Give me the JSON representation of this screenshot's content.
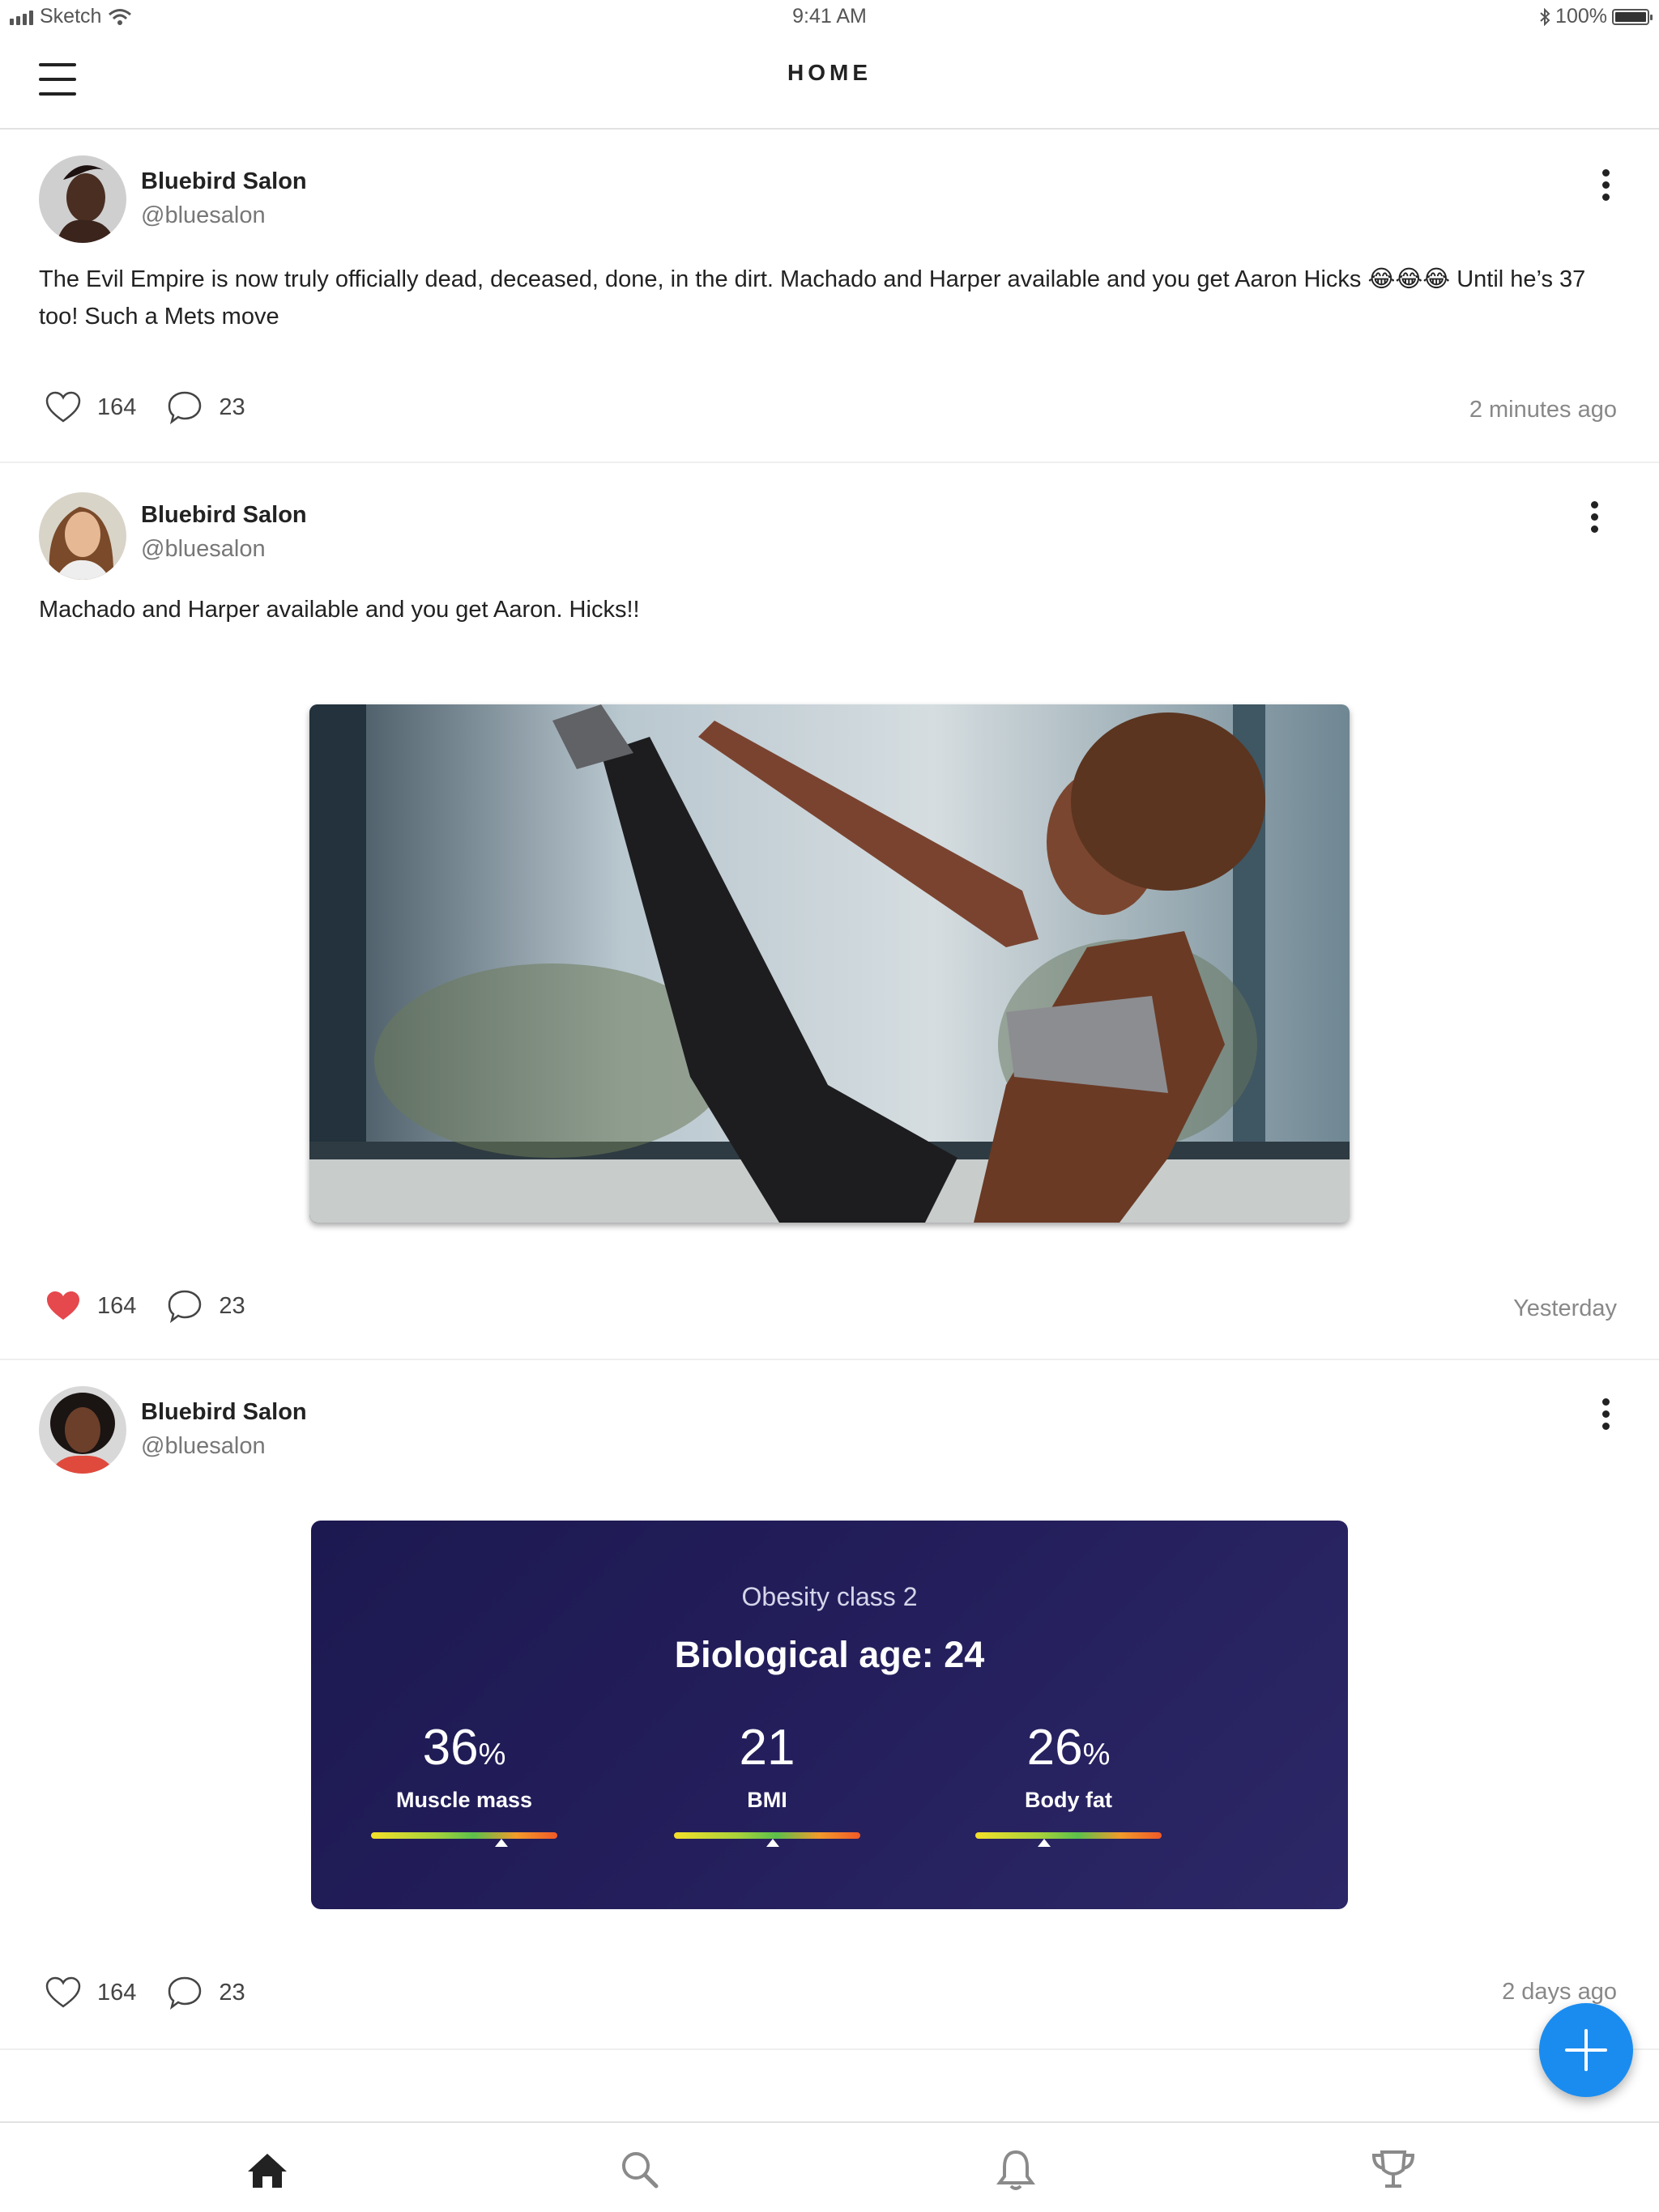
{
  "status_bar": {
    "carrier": "Sketch",
    "time": "9:41 AM",
    "battery": "100%",
    "battery_level": 1.0
  },
  "nav": {
    "title": "HOME"
  },
  "posts": [
    {
      "user": "Bluebird Salon",
      "handle": "@bluesalon",
      "text": "The Evil Empire is now truly officially dead, deceased, done, in the dirt. Machado and Harper available and you get Aaron Hicks 😂😂😂 Until he’s 37 too! Such a Mets move",
      "likes": "164",
      "comments": "23",
      "liked": false,
      "time": "2 minutes ago"
    },
    {
      "user": "Bluebird Salon",
      "handle": "@bluesalon",
      "text": "Machado and Harper available and you get Aaron. Hicks!!",
      "likes": "164",
      "comments": "23",
      "liked": true,
      "time": "Yesterday"
    },
    {
      "user": "Bluebird Salon",
      "handle": "@bluesalon",
      "likes": "164",
      "comments": "23",
      "liked": false,
      "time": "2 days ago",
      "card": {
        "classification": "Obesity class 2",
        "bio_age": "Biological age: 24",
        "metrics": [
          {
            "value": "36",
            "unit": "%",
            "label": "Muscle mass",
            "indicator": 0.7
          },
          {
            "value": "21",
            "unit": "",
            "label": "BMI",
            "indicator": 0.53
          },
          {
            "value": "26",
            "unit": "%",
            "label": "Body fat",
            "indicator": 0.37
          }
        ]
      }
    }
  ],
  "tabs": [
    "home-icon",
    "search-icon",
    "bell-icon",
    "trophy-icon"
  ],
  "colors": {
    "accent": "#1a8cf0",
    "like": "#e5484d",
    "card_bg": "#211c58"
  }
}
